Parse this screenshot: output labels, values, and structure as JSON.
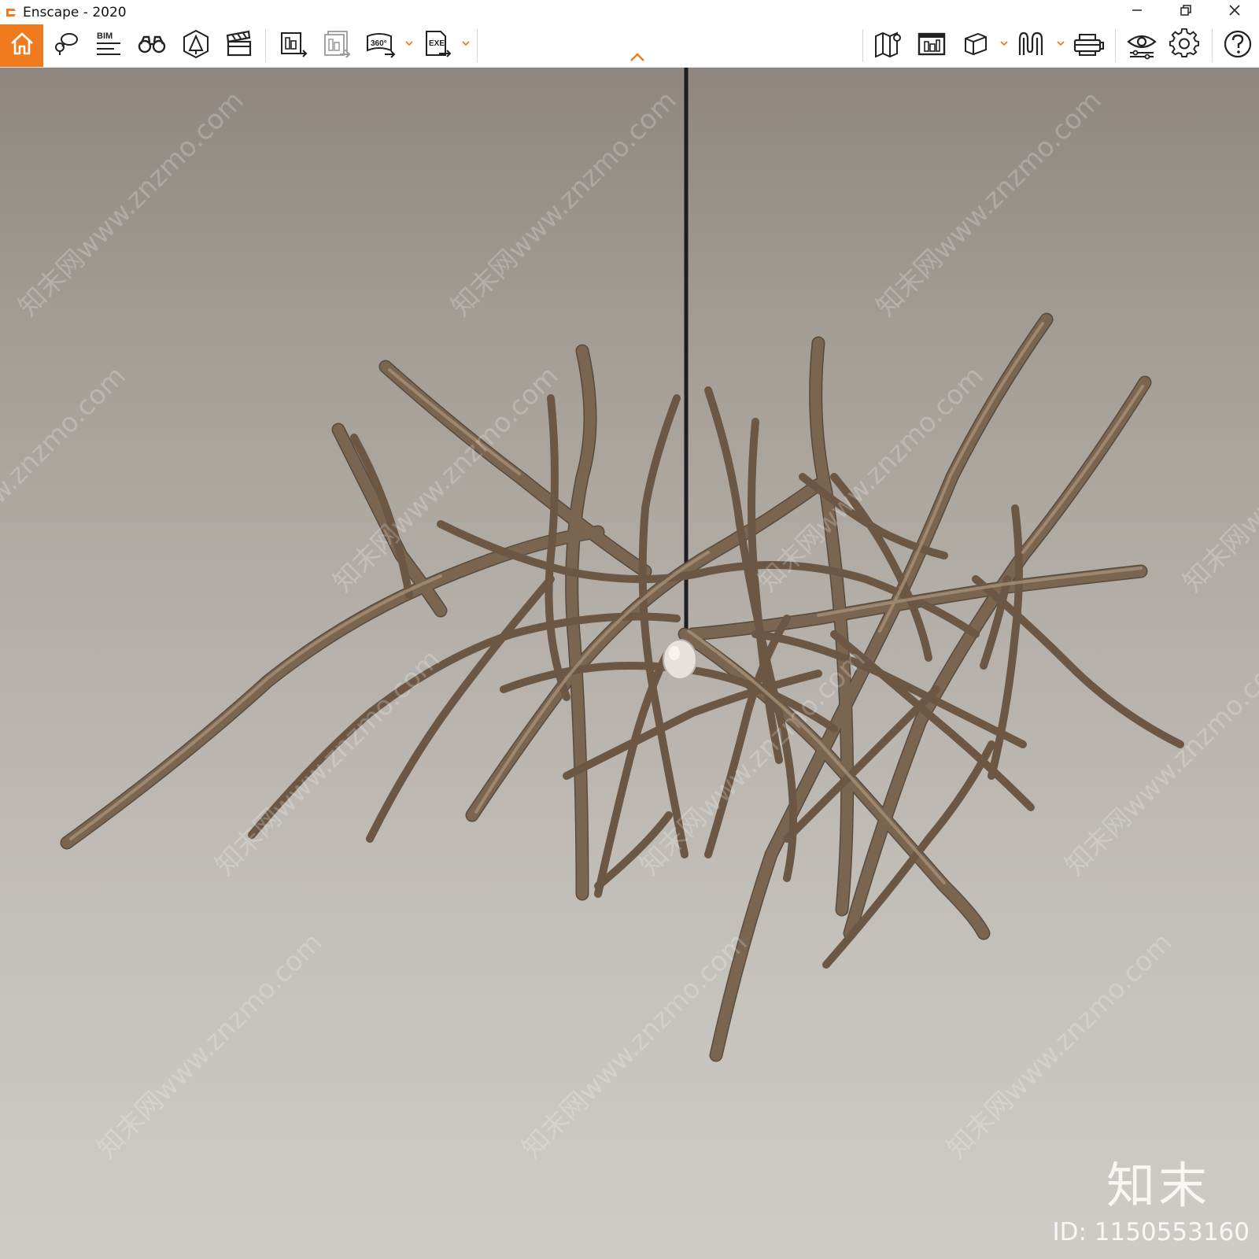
{
  "window": {
    "title": "Enscape - 2020",
    "controls": [
      "minimize-icon",
      "restore-icon",
      "close-icon"
    ]
  },
  "toolbar": {
    "accent_color": "#f07a1e",
    "bim_label": "BIM",
    "left_tools": [
      "home-icon",
      "view-management-icon",
      "bim-icon",
      "binoculars-icon",
      "asset-library-icon",
      "video-editor-icon",
      "render-image-icon",
      "batch-render-icon",
      "render-360-icon",
      "export-exe-icon"
    ],
    "right_tools": [
      "map-icon",
      "capture-icon",
      "cube-view-icon",
      "sync-icon",
      "vr-headset-icon",
      "visual-settings-icon",
      "settings-gear-icon",
      "help-icon"
    ],
    "panorama_label": "360°",
    "exe_label": "EXE"
  },
  "viewport": {
    "background_top": "#8f877f",
    "background_bottom": "#cfccc7",
    "wood_color": "#6e5a45",
    "watermark_text": "知末网www.znzmo.com",
    "brand_text": "知末",
    "image_id": "ID: 1150553160"
  }
}
